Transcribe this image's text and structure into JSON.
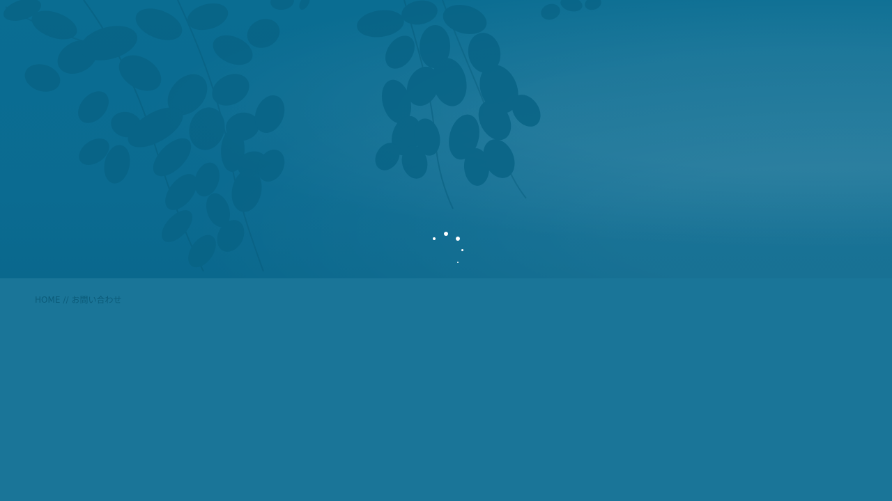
{
  "hero": {
    "background_color": "#0b6b91"
  },
  "loader": {
    "color": "#ffffff"
  },
  "breadcrumb": {
    "home_label": "HOME",
    "separator": "//",
    "current_label": "お問い合わせ",
    "text_color": "#0b5b79"
  },
  "page": {
    "background_color": "#1a7598"
  }
}
